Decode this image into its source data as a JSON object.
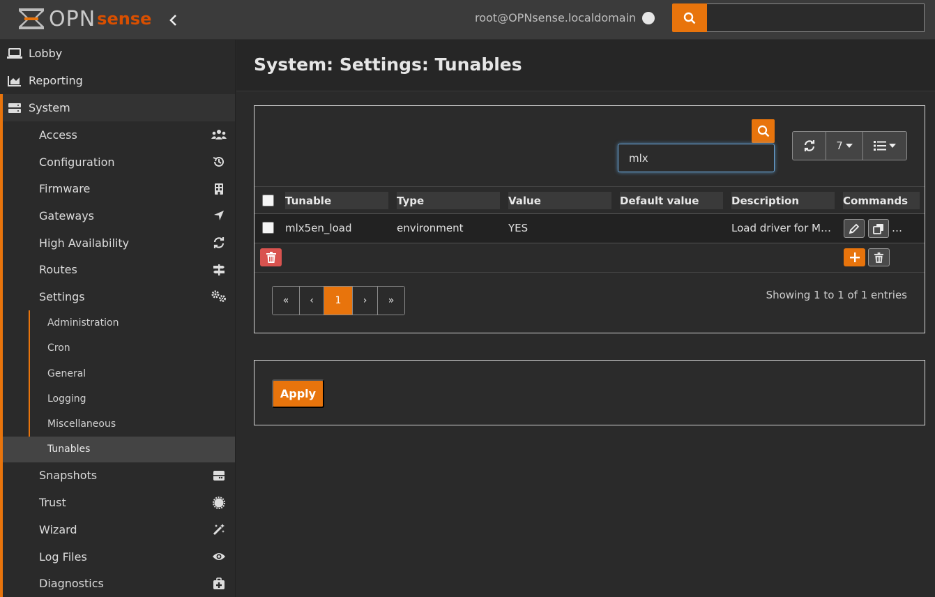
{
  "header": {
    "logo_main": "OPN",
    "logo_sense": "sense",
    "user": "root@OPNsense.localdomain",
    "search_value": ""
  },
  "sidebar": {
    "lobby": "Lobby",
    "reporting": "Reporting",
    "system": "System",
    "system_items": [
      {
        "label": "Access",
        "icon": "users-icon"
      },
      {
        "label": "Configuration",
        "icon": "history-icon"
      },
      {
        "label": "Firmware",
        "icon": "building-icon"
      },
      {
        "label": "Gateways",
        "icon": "location-arrow-icon"
      },
      {
        "label": "High Availability",
        "icon": "refresh-icon"
      },
      {
        "label": "Routes",
        "icon": "signpost-icon"
      },
      {
        "label": "Settings",
        "icon": "cogs-icon"
      }
    ],
    "settings_sub": [
      "Administration",
      "Cron",
      "General",
      "Logging",
      "Miscellaneous",
      "Tunables"
    ],
    "system_items_after": [
      {
        "label": "Snapshots",
        "icon": "hdd-icon"
      },
      {
        "label": "Trust",
        "icon": "certificate-icon"
      },
      {
        "label": "Wizard",
        "icon": "magic-icon"
      },
      {
        "label": "Log Files",
        "icon": "eye-icon"
      },
      {
        "label": "Diagnostics",
        "icon": "medkit-icon"
      }
    ]
  },
  "main": {
    "title": "System: Settings: Tunables",
    "grid": {
      "search_value": "mlx",
      "page_size": "7",
      "columns": [
        "Tunable",
        "Type",
        "Value",
        "Default value",
        "Description",
        "Commands"
      ],
      "rows": [
        {
          "tunable": "mlx5en_load",
          "type": "environment",
          "value": "YES",
          "default": "",
          "description": "Load driver for M…",
          "more": "…"
        }
      ],
      "pagination": [
        "«",
        "‹",
        "1",
        "›",
        "»"
      ],
      "showing": "Showing 1 to 1 of 1 entries"
    },
    "apply_label": "Apply"
  },
  "colors": {
    "accent": "#e8740c",
    "danger": "#d9534f"
  }
}
